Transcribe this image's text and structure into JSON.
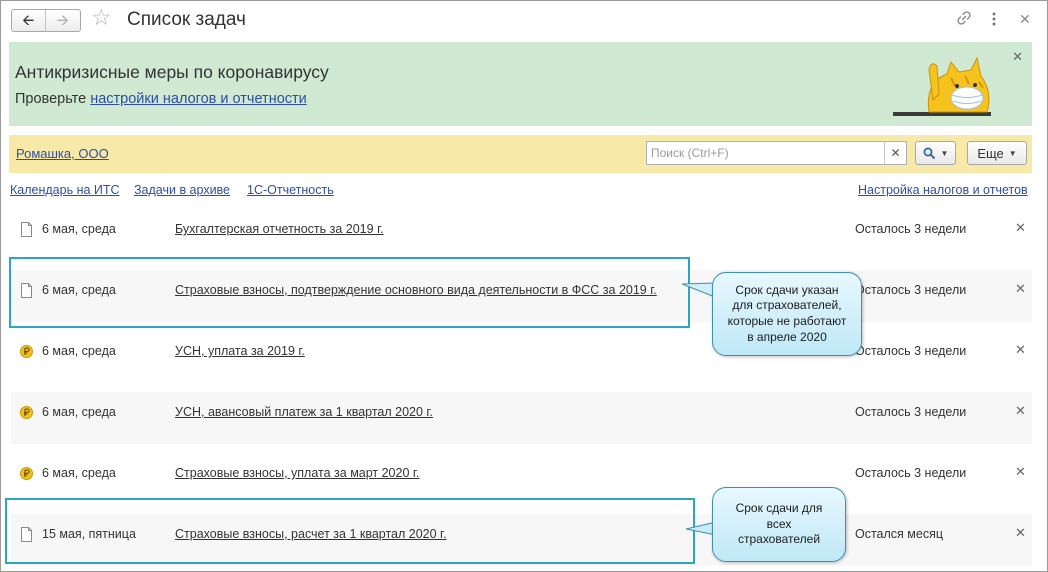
{
  "window": {
    "title": "Список задач"
  },
  "banner": {
    "title": "Антикризисные меры по коронавирусу",
    "prefix": "Проверьте ",
    "link": "настройки налогов и отчетности"
  },
  "toolbar": {
    "organization": "Ромашка, ООО",
    "search_placeholder": "Поиск (Ctrl+F)",
    "search_value": "",
    "more_label": "Еще"
  },
  "links": {
    "calendar": "Календарь на ИТС",
    "archive": "Задачи в архиве",
    "reporting": "1С-Отчетность",
    "settings": "Настройка налогов и отчетов"
  },
  "tasks": [
    {
      "icon": "document-icon",
      "date": "6 мая, среда",
      "title": "Бухгалтерская отчетность за 2019 г.",
      "status": "Осталось 3 недели"
    },
    {
      "icon": "document-icon",
      "date": "6 мая, среда",
      "title": "Страховые взносы, подтверждение основного вида деятельности в ФСС за 2019 г.",
      "status": "Осталось 3 недели"
    },
    {
      "icon": "ruble-coin-icon",
      "date": "6 мая, среда",
      "title": "УСН, уплата за 2019 г.",
      "status": "Осталось 3 недели"
    },
    {
      "icon": "ruble-coin-icon",
      "date": "6 мая, среда",
      "title": "УСН, авансовый платеж за 1 квартал 2020 г.",
      "status": "Осталось 3 недели"
    },
    {
      "icon": "ruble-coin-icon",
      "date": "6 мая, среда",
      "title": "Страховые взносы, уплата за март 2020 г.",
      "status": "Осталось 3 недели"
    },
    {
      "icon": "document-icon",
      "date": "15 мая, пятница",
      "title": "Страховые взносы, расчет за 1 квартал 2020 г.",
      "status": "Остался месяц"
    }
  ],
  "callouts": [
    "Срок сдачи указан\nдля страхователей,\nкоторые не работают\nв апреле 2020",
    "Срок сдачи для\nвсех\nстрахователей"
  ],
  "colors": {
    "banner_bg": "#cfe9d2",
    "orgbar_bg": "#f7e9a8",
    "link": "#2f4ea0",
    "highlight": "#2aa5c4",
    "callout_bg": "#bfe8f7"
  }
}
